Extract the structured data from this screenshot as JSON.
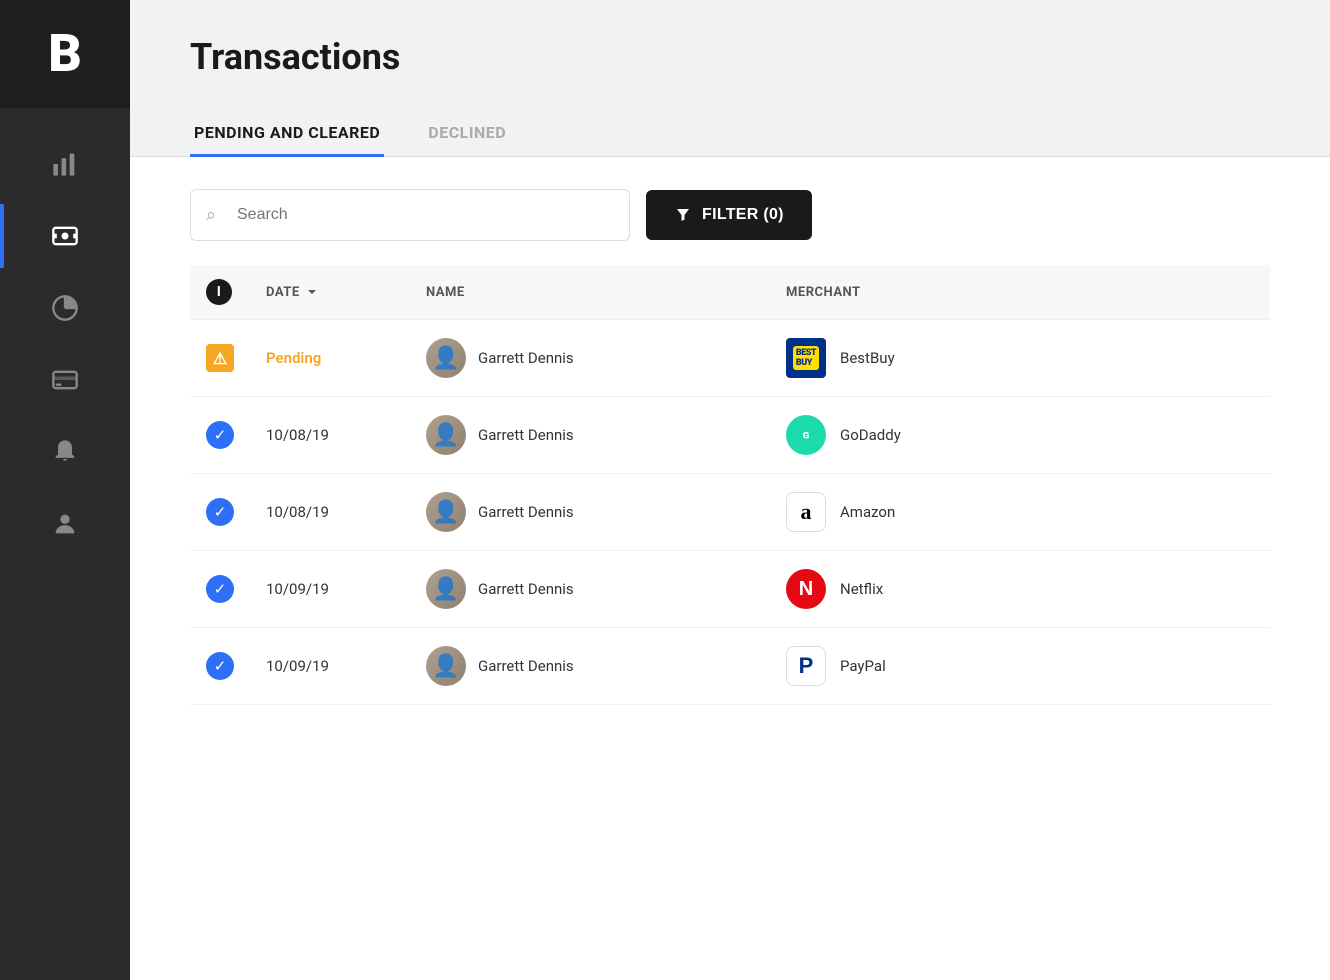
{
  "sidebar": {
    "logo": "B",
    "items": [
      {
        "id": "analytics",
        "icon": "bar-chart-icon",
        "active": false
      },
      {
        "id": "transactions",
        "icon": "dollar-icon",
        "active": true
      },
      {
        "id": "reports",
        "icon": "pie-chart-icon",
        "active": false
      },
      {
        "id": "cards",
        "icon": "card-icon",
        "active": false
      },
      {
        "id": "notifications",
        "icon": "bell-icon",
        "active": false
      },
      {
        "id": "profile",
        "icon": "user-icon",
        "active": false
      }
    ]
  },
  "page": {
    "title": "Transactions"
  },
  "tabs": [
    {
      "id": "pending-cleared",
      "label": "PENDING AND CLEARED",
      "active": true
    },
    {
      "id": "declined",
      "label": "DECLINED",
      "active": false
    }
  ],
  "toolbar": {
    "search_placeholder": "Search",
    "filter_label": "FILTER (0)"
  },
  "table": {
    "columns": [
      {
        "id": "status-col",
        "label": "ℹ"
      },
      {
        "id": "date-col",
        "label": "DATE"
      },
      {
        "id": "name-col",
        "label": "NAME"
      },
      {
        "id": "merchant-col",
        "label": "MERCHANT"
      }
    ],
    "rows": [
      {
        "status": "pending",
        "date": "Pending",
        "name": "Garrett Dennis",
        "merchant_name": "BestBuy",
        "merchant_type": "bestbuy",
        "merchant_logo": "BEST BUY"
      },
      {
        "status": "cleared",
        "date": "10/08/19",
        "name": "Garrett Dennis",
        "merchant_name": "GoDaddy",
        "merchant_type": "godaddy",
        "merchant_logo": "GD"
      },
      {
        "status": "cleared",
        "date": "10/08/19",
        "name": "Garrett Dennis",
        "merchant_name": "Amazon",
        "merchant_type": "amazon",
        "merchant_logo": "a"
      },
      {
        "status": "cleared",
        "date": "10/09/19",
        "name": "Garrett Dennis",
        "merchant_name": "Netflix",
        "merchant_type": "netflix",
        "merchant_logo": "N"
      },
      {
        "status": "cleared",
        "date": "10/09/19",
        "name": "Garrett Dennis",
        "merchant_name": "PayPal",
        "merchant_type": "paypal",
        "merchant_logo": "P"
      }
    ]
  },
  "colors": {
    "accent_blue": "#2e6ff7",
    "pending_yellow": "#f5a623",
    "sidebar_bg": "#2b2b2e",
    "cleared_blue": "#2e6ff7"
  }
}
